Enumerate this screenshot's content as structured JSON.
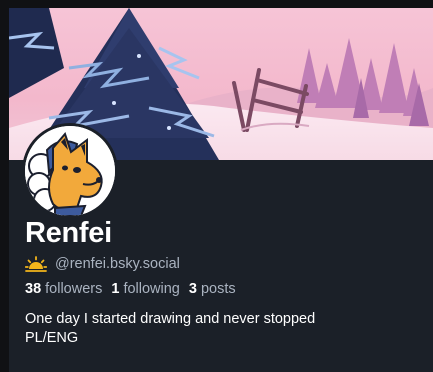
{
  "profile": {
    "display_name": "Renfei",
    "handle": "@renfei.bsky.social",
    "handle_icon": "sun-icon",
    "stats": {
      "followers_count": "38",
      "followers_label": "followers",
      "following_count": "1",
      "following_label": "following",
      "posts_count": "3",
      "posts_label": "posts"
    },
    "bio_lines": [
      "One day I started drawing and never stopped",
      "PL/ENG"
    ]
  },
  "colors": {
    "page_background": "#101114",
    "card_background": "#1b2028",
    "secondary_text": "#aab3c0",
    "sun_icon": "#f3b51b",
    "avatar_fox": "#f2a93b"
  }
}
